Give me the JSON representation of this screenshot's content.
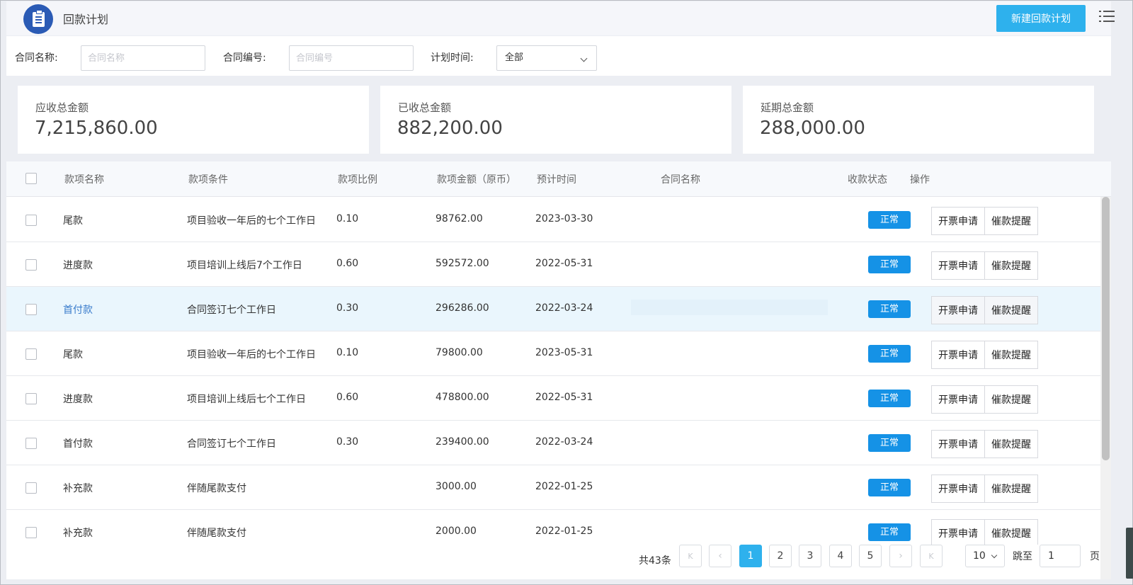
{
  "header": {
    "title": "回款计划",
    "new_button": "新建回款计划"
  },
  "filters": {
    "contract_name": {
      "label": "合同名称:",
      "placeholder": "合同名称",
      "value": ""
    },
    "contract_no": {
      "label": "合同编号:",
      "placeholder": "合同编号",
      "value": ""
    },
    "plan_time": {
      "label": "计划时间:",
      "value": "全部"
    }
  },
  "stats": [
    {
      "label": "应收总金额",
      "value": "7,215,860.00"
    },
    {
      "label": "已收总金额",
      "value": "882,200.00"
    },
    {
      "label": "延期总金额",
      "value": "288,000.00"
    }
  ],
  "table": {
    "headers": {
      "name": "款项名称",
      "condition": "款项条件",
      "ratio": "款项比例",
      "amount": "款项金额（原币）",
      "date": "预计时间",
      "contract": "合同名称",
      "status": "收款状态",
      "actions": "操作"
    },
    "actions": {
      "invoice": "开票申请",
      "remind": "催款提醒"
    },
    "rows": [
      {
        "name": "尾款",
        "condition": "项目验收一年后的七个工作日",
        "ratio": "0.10",
        "amount": "98762.00",
        "date": "2023-03-30",
        "contract": "",
        "status": "正常"
      },
      {
        "name": "进度款",
        "condition": "项目培训上线后7个工作日",
        "ratio": "0.60",
        "amount": "592572.00",
        "date": "2022-05-31",
        "contract": "",
        "status": "正常"
      },
      {
        "name": "首付款",
        "condition": "合同签订七个工作日",
        "ratio": "0.30",
        "amount": "296286.00",
        "date": "2022-03-24",
        "contract": "",
        "status": "正常"
      },
      {
        "name": "尾款",
        "condition": "项目验收一年后的七个工作日",
        "ratio": "0.10",
        "amount": "79800.00",
        "date": "2023-05-31",
        "contract": "",
        "status": "正常"
      },
      {
        "name": "进度款",
        "condition": "项目培训上线后七个工作日",
        "ratio": "0.60",
        "amount": "478800.00",
        "date": "2022-05-31",
        "contract": "",
        "status": "正常"
      },
      {
        "name": "首付款",
        "condition": "合同签订七个工作日",
        "ratio": "0.30",
        "amount": "239400.00",
        "date": "2022-03-24",
        "contract": "",
        "status": "正常"
      },
      {
        "name": "补充款",
        "condition": "伴随尾款支付",
        "ratio": "",
        "amount": "3000.00",
        "date": "2022-01-25",
        "contract": "",
        "status": "正常"
      },
      {
        "name": "补充款",
        "condition": "伴随尾款支付",
        "ratio": "",
        "amount": "2000.00",
        "date": "2022-01-25",
        "contract": "",
        "status": "正常"
      }
    ]
  },
  "pagination": {
    "total": "共43条",
    "pages": [
      "1",
      "2",
      "3",
      "4",
      "5"
    ],
    "current": "1",
    "page_size": "10",
    "jump_label": "跳至",
    "jump_value": "1",
    "jump_suffix": "页",
    "first_icon": "K",
    "prev_icon": "‹",
    "next_icon": "›",
    "last_icon": "K"
  },
  "colors": {
    "accent": "#2eb1ed",
    "status_badge": "#1592e6",
    "logo": "#2b5bb5",
    "highlight_row": "#eaf6fd"
  }
}
